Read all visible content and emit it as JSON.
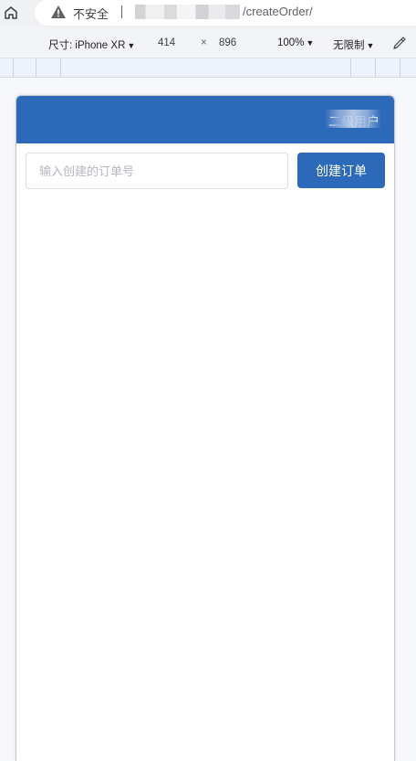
{
  "browser": {
    "security_label": "不安全",
    "url_path": "/createOrder/",
    "icons": [
      "home-icon",
      "warning-icon"
    ]
  },
  "device_toolbar": {
    "device_label": "尺寸: iPhone XR",
    "width": "414",
    "times": "×",
    "height": "896",
    "zoom": "100%",
    "throttle": "无限制",
    "icons": [
      "eyedropper-icon"
    ]
  },
  "app": {
    "header_user": "二级用户",
    "order_input_placeholder": "输入创建的订单号",
    "order_input_value": "",
    "create_button_label": "创建订单",
    "colors": {
      "primary": "#2c69b9",
      "input_border": "#dcdfe6",
      "placeholder": "#b4b8bf"
    }
  }
}
